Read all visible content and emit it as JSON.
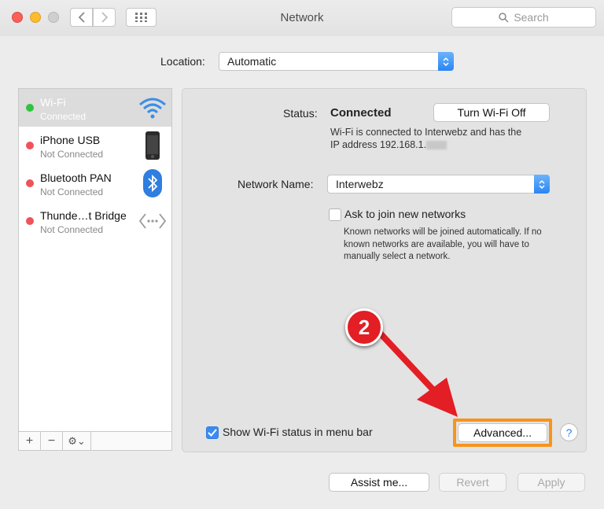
{
  "window": {
    "title": "Network"
  },
  "toolbar": {
    "search_placeholder": "Search"
  },
  "location": {
    "label": "Location:",
    "value": "Automatic"
  },
  "services": [
    {
      "name": "Wi-Fi",
      "status": "Connected",
      "state_color": "#2fc43e",
      "icon": "wifi-icon",
      "selected": true
    },
    {
      "name": "iPhone USB",
      "status": "Not Connected",
      "state_color": "#f0525a",
      "icon": "iphone-icon"
    },
    {
      "name": "Bluetooth PAN",
      "status": "Not Connected",
      "state_color": "#f0525a",
      "icon": "bluetooth-icon"
    },
    {
      "name": "Thunde…t Bridge",
      "status": "Not Connected",
      "state_color": "#f0525a",
      "icon": "thunderbolt-bridge-icon"
    }
  ],
  "sidebar_controls": {
    "add": "+",
    "remove": "−",
    "gear": "⚙︎⌄"
  },
  "detail": {
    "status_label": "Status:",
    "status_value": "Connected",
    "turn_off_label": "Turn Wi-Fi Off",
    "status_desc_line1": "Wi-Fi is connected to Interwebz and has the",
    "status_desc_line2": "IP address 192.168.1.",
    "network_name_label": "Network Name:",
    "network_name_value": "Interwebz",
    "ask_join_label": "Ask to join new networks",
    "ask_join_desc": "Known networks will be joined automatically. If no known networks are available, you will have to manually select a network.",
    "ask_join_checked": false,
    "show_status_label": "Show Wi-Fi status in menu bar",
    "show_status_checked": true,
    "advanced_label": "Advanced...",
    "help_label": "?"
  },
  "footer": {
    "assist_label": "Assist me...",
    "revert_label": "Revert",
    "apply_label": "Apply"
  },
  "annotation": {
    "step_number": "2",
    "callout_color": "#e31e24",
    "highlight_color": "#f7941d"
  }
}
